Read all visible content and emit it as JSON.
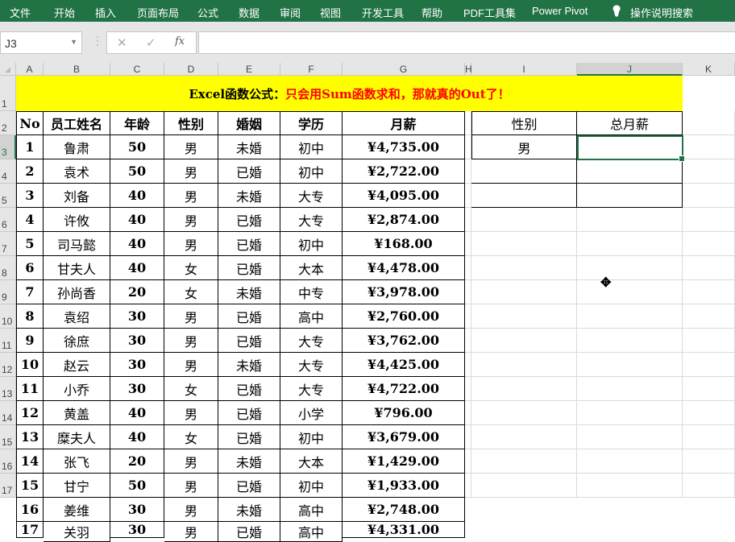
{
  "ribbon": {
    "tabs": [
      "文件",
      "开始",
      "插入",
      "页面布局",
      "公式",
      "数据",
      "审阅",
      "视图",
      "开发工具",
      "帮助",
      "PDF工具集",
      "Power Pivot"
    ],
    "search_label": "操作说明搜索",
    "search_icon": "lightbulb-icon"
  },
  "formula_bar": {
    "name_box": "J3",
    "cancel_icon": "✕",
    "enter_icon": "✓",
    "fx_label": "fx",
    "formula": ""
  },
  "columns": [
    "A",
    "B",
    "C",
    "D",
    "E",
    "F",
    "G",
    "H",
    "I",
    "J",
    "K"
  ],
  "rows": [
    "1",
    "2",
    "3",
    "4",
    "5",
    "6",
    "7",
    "8",
    "9",
    "10",
    "11",
    "12",
    "13",
    "14",
    "15",
    "16",
    "17"
  ],
  "title": {
    "black": "Excel函数公式：",
    "red": "只会用Sum函数求和，那就真的Out了！",
    "red_color": "#ff0000",
    "bg": "#ffff00"
  },
  "table": {
    "headers": [
      "No",
      "员工姓名",
      "年龄",
      "性别",
      "婚姻",
      "学历",
      "月薪"
    ],
    "rows": [
      [
        "1",
        "鲁肃",
        "50",
        "男",
        "未婚",
        "初中",
        "¥4,735.00"
      ],
      [
        "2",
        "袁术",
        "50",
        "男",
        "已婚",
        "初中",
        "¥2,722.00"
      ],
      [
        "3",
        "刘备",
        "40",
        "男",
        "未婚",
        "大专",
        "¥4,095.00"
      ],
      [
        "4",
        "许攸",
        "40",
        "男",
        "已婚",
        "大专",
        "¥2,874.00"
      ],
      [
        "5",
        "司马懿",
        "40",
        "男",
        "已婚",
        "初中",
        "¥168.00"
      ],
      [
        "6",
        "甘夫人",
        "40",
        "女",
        "已婚",
        "大本",
        "¥4,478.00"
      ],
      [
        "7",
        "孙尚香",
        "20",
        "女",
        "未婚",
        "中专",
        "¥3,978.00"
      ],
      [
        "8",
        "袁绍",
        "30",
        "男",
        "已婚",
        "高中",
        "¥2,760.00"
      ],
      [
        "9",
        "徐庶",
        "30",
        "男",
        "已婚",
        "大专",
        "¥3,762.00"
      ],
      [
        "10",
        "赵云",
        "30",
        "男",
        "未婚",
        "大专",
        "¥4,425.00"
      ],
      [
        "11",
        "小乔",
        "30",
        "女",
        "已婚",
        "大专",
        "¥4,722.00"
      ],
      [
        "12",
        "黄盖",
        "40",
        "男",
        "已婚",
        "小学",
        "¥796.00"
      ],
      [
        "13",
        "糜夫人",
        "40",
        "女",
        "已婚",
        "初中",
        "¥3,679.00"
      ],
      [
        "14",
        "张飞",
        "20",
        "男",
        "未婚",
        "大本",
        "¥1,429.00"
      ],
      [
        "15",
        "甘宁",
        "50",
        "男",
        "已婚",
        "初中",
        "¥1,933.00"
      ],
      [
        "16",
        "姜维",
        "30",
        "男",
        "未婚",
        "高中",
        "¥2,748.00"
      ],
      [
        "17",
        "关羽",
        "30",
        "男",
        "已婚",
        "高中",
        "¥4,331.00"
      ]
    ]
  },
  "summary": {
    "headers": [
      "性别",
      "总月薪"
    ],
    "rows": [
      [
        "男",
        ""
      ],
      [
        "",
        ""
      ],
      [
        "",
        ""
      ]
    ]
  },
  "accent": "#217346"
}
